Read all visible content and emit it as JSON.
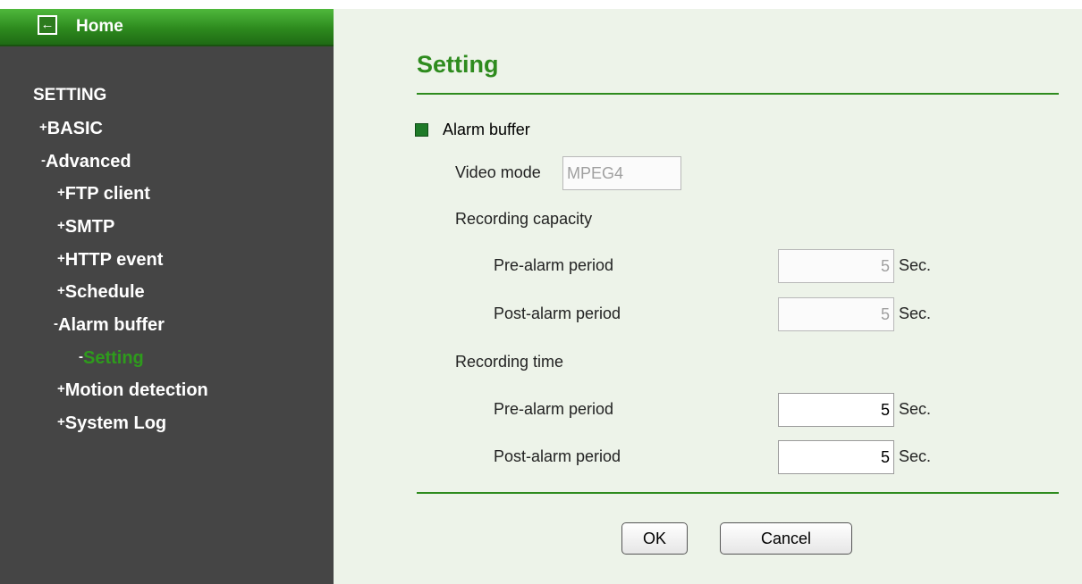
{
  "sidebar": {
    "home_label": "Home",
    "home_icon": "back-arrow-icon",
    "section_title": "SETTING",
    "items": [
      {
        "prefix": "+",
        "label": "BASIC"
      },
      {
        "prefix": "-",
        "label": "Advanced"
      },
      {
        "prefix": "+",
        "label": "FTP client"
      },
      {
        "prefix": "+",
        "label": "SMTP"
      },
      {
        "prefix": "+",
        "label": "HTTP event"
      },
      {
        "prefix": "+",
        "label": "Schedule"
      },
      {
        "prefix": "-",
        "label": "Alarm buffer"
      },
      {
        "prefix": "-",
        "label": "Setting",
        "active": true
      },
      {
        "prefix": "+",
        "label": "Motion detection"
      },
      {
        "prefix": "+",
        "label": "System Log"
      }
    ]
  },
  "main": {
    "title": "Setting",
    "section_title": "Alarm buffer",
    "video_mode": {
      "label": "Video mode",
      "value": "MPEG4"
    },
    "capacity": {
      "heading": "Recording capacity",
      "pre_label": "Pre-alarm period",
      "pre_value": "5",
      "post_label": "Post-alarm period",
      "post_value": "5"
    },
    "time": {
      "heading": "Recording time",
      "pre_label": "Pre-alarm period",
      "pre_value": "5",
      "post_label": "Post-alarm period",
      "post_value": "5"
    },
    "unit": "Sec.",
    "ok_label": "OK",
    "cancel_label": "Cancel"
  },
  "colors": {
    "accent_green": "#2e8b1e",
    "sidebar_bg": "#454545",
    "main_bg": "#edf3e9"
  }
}
